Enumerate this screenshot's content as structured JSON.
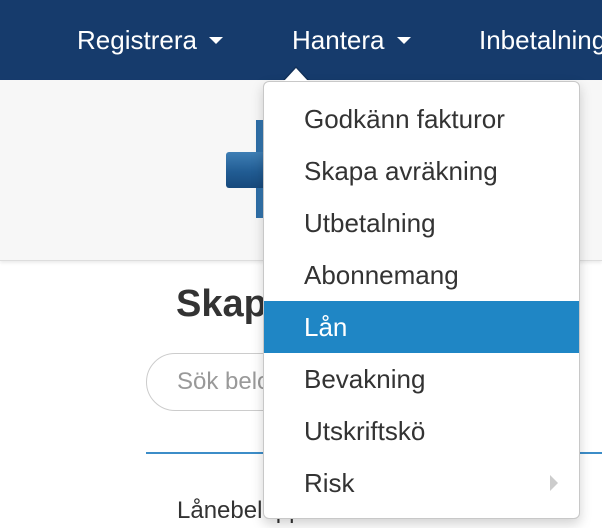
{
  "navbar": {
    "items": [
      {
        "label": "Registrera",
        "has_dropdown": true
      },
      {
        "label": "Hantera",
        "has_dropdown": true,
        "open": true
      },
      {
        "label": "Inbetalningar"
      }
    ]
  },
  "page": {
    "title": "Skapa",
    "search_placeholder": "Sök belopp",
    "amount_label": "Lånebelopp"
  },
  "dropdown": {
    "items": [
      {
        "label": "Godkänn fakturor"
      },
      {
        "label": "Skapa avräkning"
      },
      {
        "label": "Utbetalning"
      },
      {
        "label": "Abonnemang"
      },
      {
        "label": "Lån",
        "active": true
      },
      {
        "label": "Bevakning"
      },
      {
        "label": "Utskriftskö"
      },
      {
        "label": "Risk",
        "has_submenu": true
      }
    ]
  },
  "colors": {
    "navbar_bg": "#163b6c",
    "active_item_bg": "#1f86c5",
    "divider": "#3c8dc8"
  },
  "icons": {
    "dropdown_caret": "caret-down-icon",
    "submenu_caret": "caret-right-icon"
  }
}
